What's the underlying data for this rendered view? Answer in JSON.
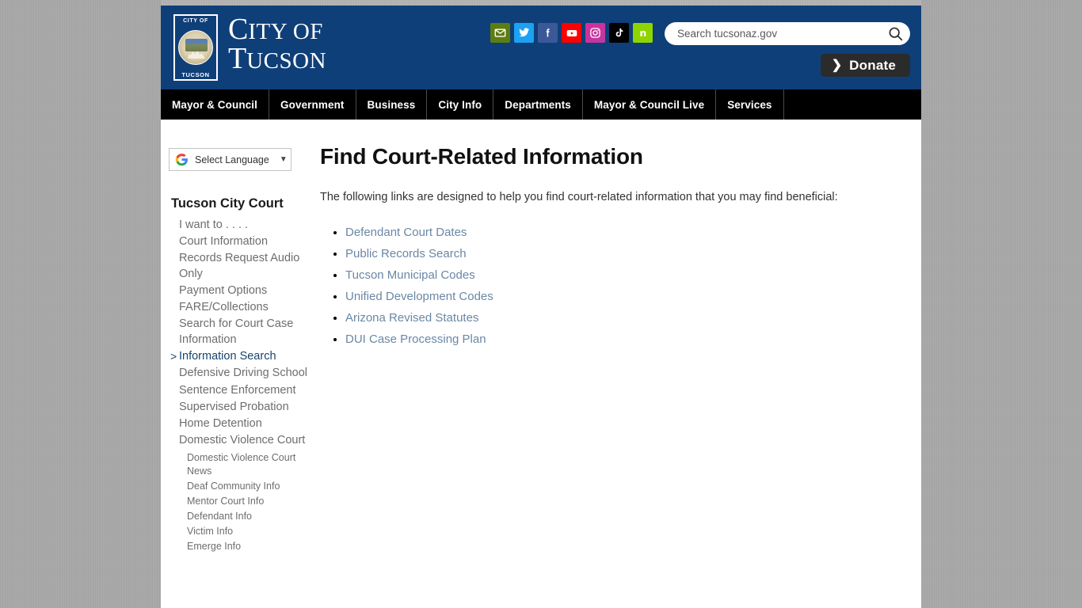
{
  "header": {
    "logo": {
      "seal_top_text": "CITY OF",
      "seal_bottom_text": "TUCSON",
      "wordmark_line1_cap": "C",
      "wordmark_line1_rest": "ITY OF",
      "wordmark_line2_cap": "T",
      "wordmark_line2_rest": "UCSON"
    },
    "social": [
      {
        "name": "email-icon",
        "label": "Email",
        "color": "#5d7c12"
      },
      {
        "name": "twitter-icon",
        "label": "Twitter",
        "color": "#1da1f2"
      },
      {
        "name": "facebook-icon",
        "label": "Facebook",
        "color": "#3b5998"
      },
      {
        "name": "youtube-icon",
        "label": "YouTube",
        "color": "#ff0000"
      },
      {
        "name": "instagram-icon",
        "label": "Instagram",
        "color": "#c9339e"
      },
      {
        "name": "tiktok-icon",
        "label": "TikTok",
        "color": "#000000"
      },
      {
        "name": "nextdoor-icon",
        "label": "Nextdoor",
        "color": "#8ed500"
      }
    ],
    "search": {
      "placeholder": "Search tucsonaz.gov",
      "value": ""
    },
    "donate": {
      "label": "Donate",
      "chevron": "❯"
    },
    "background_color": "#0f3f78"
  },
  "nav": {
    "items": [
      {
        "label": "Mayor & Council"
      },
      {
        "label": "Government"
      },
      {
        "label": "Business"
      },
      {
        "label": "City Info"
      },
      {
        "label": "Departments"
      },
      {
        "label": "Mayor & Council Live"
      },
      {
        "label": "Services"
      }
    ],
    "background_color": "#000000"
  },
  "sidebar": {
    "translate": {
      "label": "Select Language",
      "caret": "▼"
    },
    "title": "Tucson City Court",
    "items": [
      {
        "label": "I want to . . . .",
        "active": false
      },
      {
        "label": "Court Information",
        "active": false
      },
      {
        "label": "Records Request Audio Only",
        "active": false
      },
      {
        "label": "Payment Options",
        "active": false
      },
      {
        "label": "FARE/Collections",
        "active": false
      },
      {
        "label": "Search for Court Case Information",
        "active": false
      },
      {
        "label": "Information Search",
        "active": true
      },
      {
        "label": "Defensive Driving School",
        "active": false
      },
      {
        "label": "Sentence Enforcement",
        "active": false
      },
      {
        "label": "Supervised Probation",
        "active": false
      },
      {
        "label": "Home Detention",
        "active": false
      },
      {
        "label": "Domestic Violence Court",
        "active": false
      }
    ],
    "subitems": [
      {
        "label": "Domestic Violence Court News"
      },
      {
        "label": "Deaf Community Info"
      },
      {
        "label": "Mentor Court Info"
      },
      {
        "label": "Defendant Info"
      },
      {
        "label": "Victim Info"
      },
      {
        "label": "Emerge Info"
      }
    ],
    "active_marker": ">",
    "active_color": "#18446e"
  },
  "main": {
    "title": "Find Court-Related Information",
    "intro": "The following links are designed to help you find court-related information that you may find beneficial:",
    "links": [
      {
        "label": "Defendant Court Dates"
      },
      {
        "label": "Public Records Search"
      },
      {
        "label": "Tucson Municipal Codes"
      },
      {
        "label": "Unified Development Codes"
      },
      {
        "label": "Arizona Revised Statutes"
      },
      {
        "label": "DUI Case Processing Plan"
      }
    ],
    "link_color": "#6a87a6"
  }
}
